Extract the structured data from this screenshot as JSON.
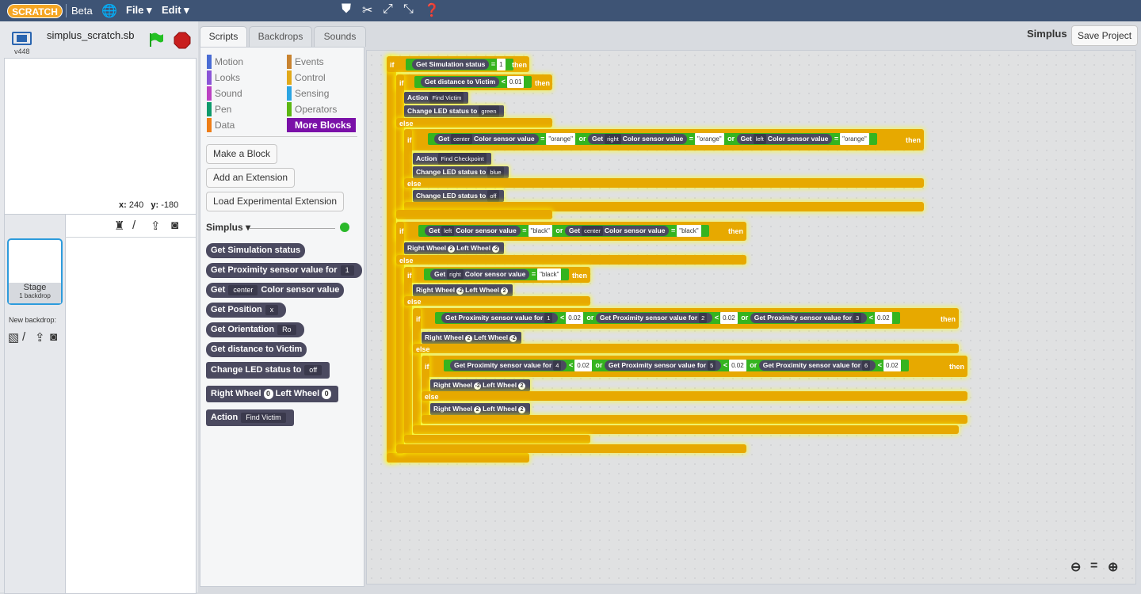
{
  "topbar": {
    "logo": "SCRATCH",
    "beta": "Beta",
    "file": "File ▾",
    "edit": "Edit ▾"
  },
  "stage": {
    "project_name": "simplus_scratch.sb",
    "version": "v448",
    "x_label": "x:",
    "x_value": "240",
    "y_label": "y:",
    "y_value": "-180"
  },
  "sprites": {
    "stage_label": "Stage",
    "backdrop_count": "1 backdrop",
    "new_backdrop": "New backdrop:"
  },
  "tabs": [
    "Scripts",
    "Backdrops",
    "Sounds"
  ],
  "categories": [
    {
      "label": "Motion",
      "color": "#4a6cd4"
    },
    {
      "label": "Looks",
      "color": "#8a55d7"
    },
    {
      "label": "Sound",
      "color": "#bb42c3"
    },
    {
      "label": "Pen",
      "color": "#0e9a6c"
    },
    {
      "label": "Data",
      "color": "#ee7d16"
    },
    {
      "label": "Events",
      "color": "#c88330"
    },
    {
      "label": "Control",
      "color": "#e1a91a"
    },
    {
      "label": "Sensing",
      "color": "#2ca5e2"
    },
    {
      "label": "Operators",
      "color": "#5cb712"
    },
    {
      "label": "More Blocks",
      "color": "#632d99"
    }
  ],
  "palette_buttons": [
    "Make a Block",
    "Add an Extension",
    "Load Experimental Extension"
  ],
  "palette_ext": "Simplus ▾",
  "palette_blocks": {
    "sim_status": "Get Simulation status",
    "prox_a": "Get Proximity sensor value for",
    "prox_v": "1",
    "color_a": "Get",
    "color_v": "center",
    "color_b": "Color sensor value",
    "pos_a": "Get Position",
    "pos_v": "x",
    "ori_a": "Get Orientation",
    "ori_v": "Ro",
    "dist": "Get distance to Victim",
    "led_a": "Change LED status to",
    "led_v": "off",
    "wh_a": "Right Wheel",
    "wh_v1": "0",
    "wh_b": "Left Wheel",
    "wh_v2": "0",
    "act_a": "Action",
    "act_v": "Find Victim"
  },
  "header": {
    "sprite_name": "Simplus",
    "save": "Save Project"
  },
  "script": {
    "kw_if": "if",
    "kw_then": "then",
    "kw_else": "else",
    "kw_or": "or",
    "c1_a": "Get Simulation status",
    "c1_op": "=",
    "c1_v": "1",
    "c2_a": "Get distance to Victim",
    "c2_op": "<",
    "c2_v": "0.01",
    "act1_a": "Action",
    "act1_v": "Find Victim",
    "led1_a": "Change LED status to",
    "led1_v": "green",
    "col_get": "Get",
    "col_sensor": "Color sensor value",
    "col_eq": "=",
    "s_center": "center",
    "s_right": "right",
    "s_left": "left",
    "v_orange": "\"orange\"",
    "v_black": "\"black\"",
    "act2_a": "Action",
    "act2_v": "Find Checkpoint",
    "led2_a": "Change LED status to",
    "led2_v": "blue",
    "led3_a": "Change LED status to",
    "led3_v": "off",
    "right_wheel": "Right Wheel",
    "left_wheel": "Left Wheel",
    "w1_r": "2",
    "w1_l": "-2",
    "w2_r": "-2",
    "w2_l": "2",
    "w3_r": "2",
    "w3_l": "-2",
    "w4_r": "-2",
    "w4_l": "2",
    "w5_r": "2",
    "w5_l": "2",
    "prox": "Get Proximity sensor value for",
    "lt": "<",
    "p_thr": "0.02",
    "p1": "1",
    "p2": "2",
    "p3": "3",
    "p4": "4",
    "p5": "5",
    "p6": "6"
  }
}
